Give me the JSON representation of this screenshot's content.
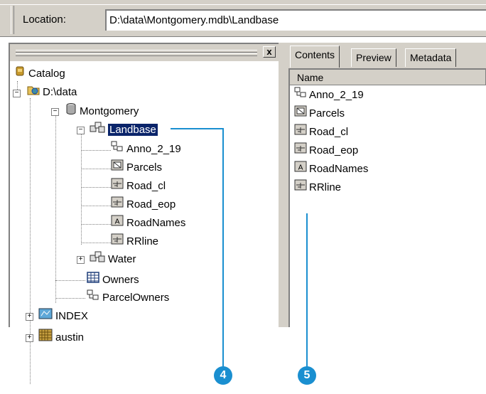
{
  "location": {
    "label": "Location:",
    "value": "D:\\data\\Montgomery.mdb\\Landbase"
  },
  "left_pane": {
    "close_label": "x",
    "tree": {
      "catalog": "Catalog",
      "folder": "D:\\data",
      "database": "Montgomery",
      "dataset_selected": "Landbase",
      "landbase_children": [
        "Anno_2_19",
        "Parcels",
        "Road_cl",
        "Road_eop",
        "RoadNames",
        "RRline"
      ],
      "water": "Water",
      "owners": "Owners",
      "parcel_owners": "ParcelOwners",
      "index": "INDEX",
      "austin": "austin"
    }
  },
  "right_pane": {
    "tabs": [
      "Contents",
      "Preview",
      "Metadata"
    ],
    "active_tab": "Contents",
    "column_header": "Name",
    "items": [
      "Anno_2_19",
      "Parcels",
      "Road_cl",
      "Road_eop",
      "RoadNames",
      "RRline"
    ]
  },
  "callouts": [
    "4",
    "5"
  ],
  "colors": {
    "selection": "#0a246a",
    "callout": "#1a8fd0",
    "chrome": "#d4d0c8"
  }
}
